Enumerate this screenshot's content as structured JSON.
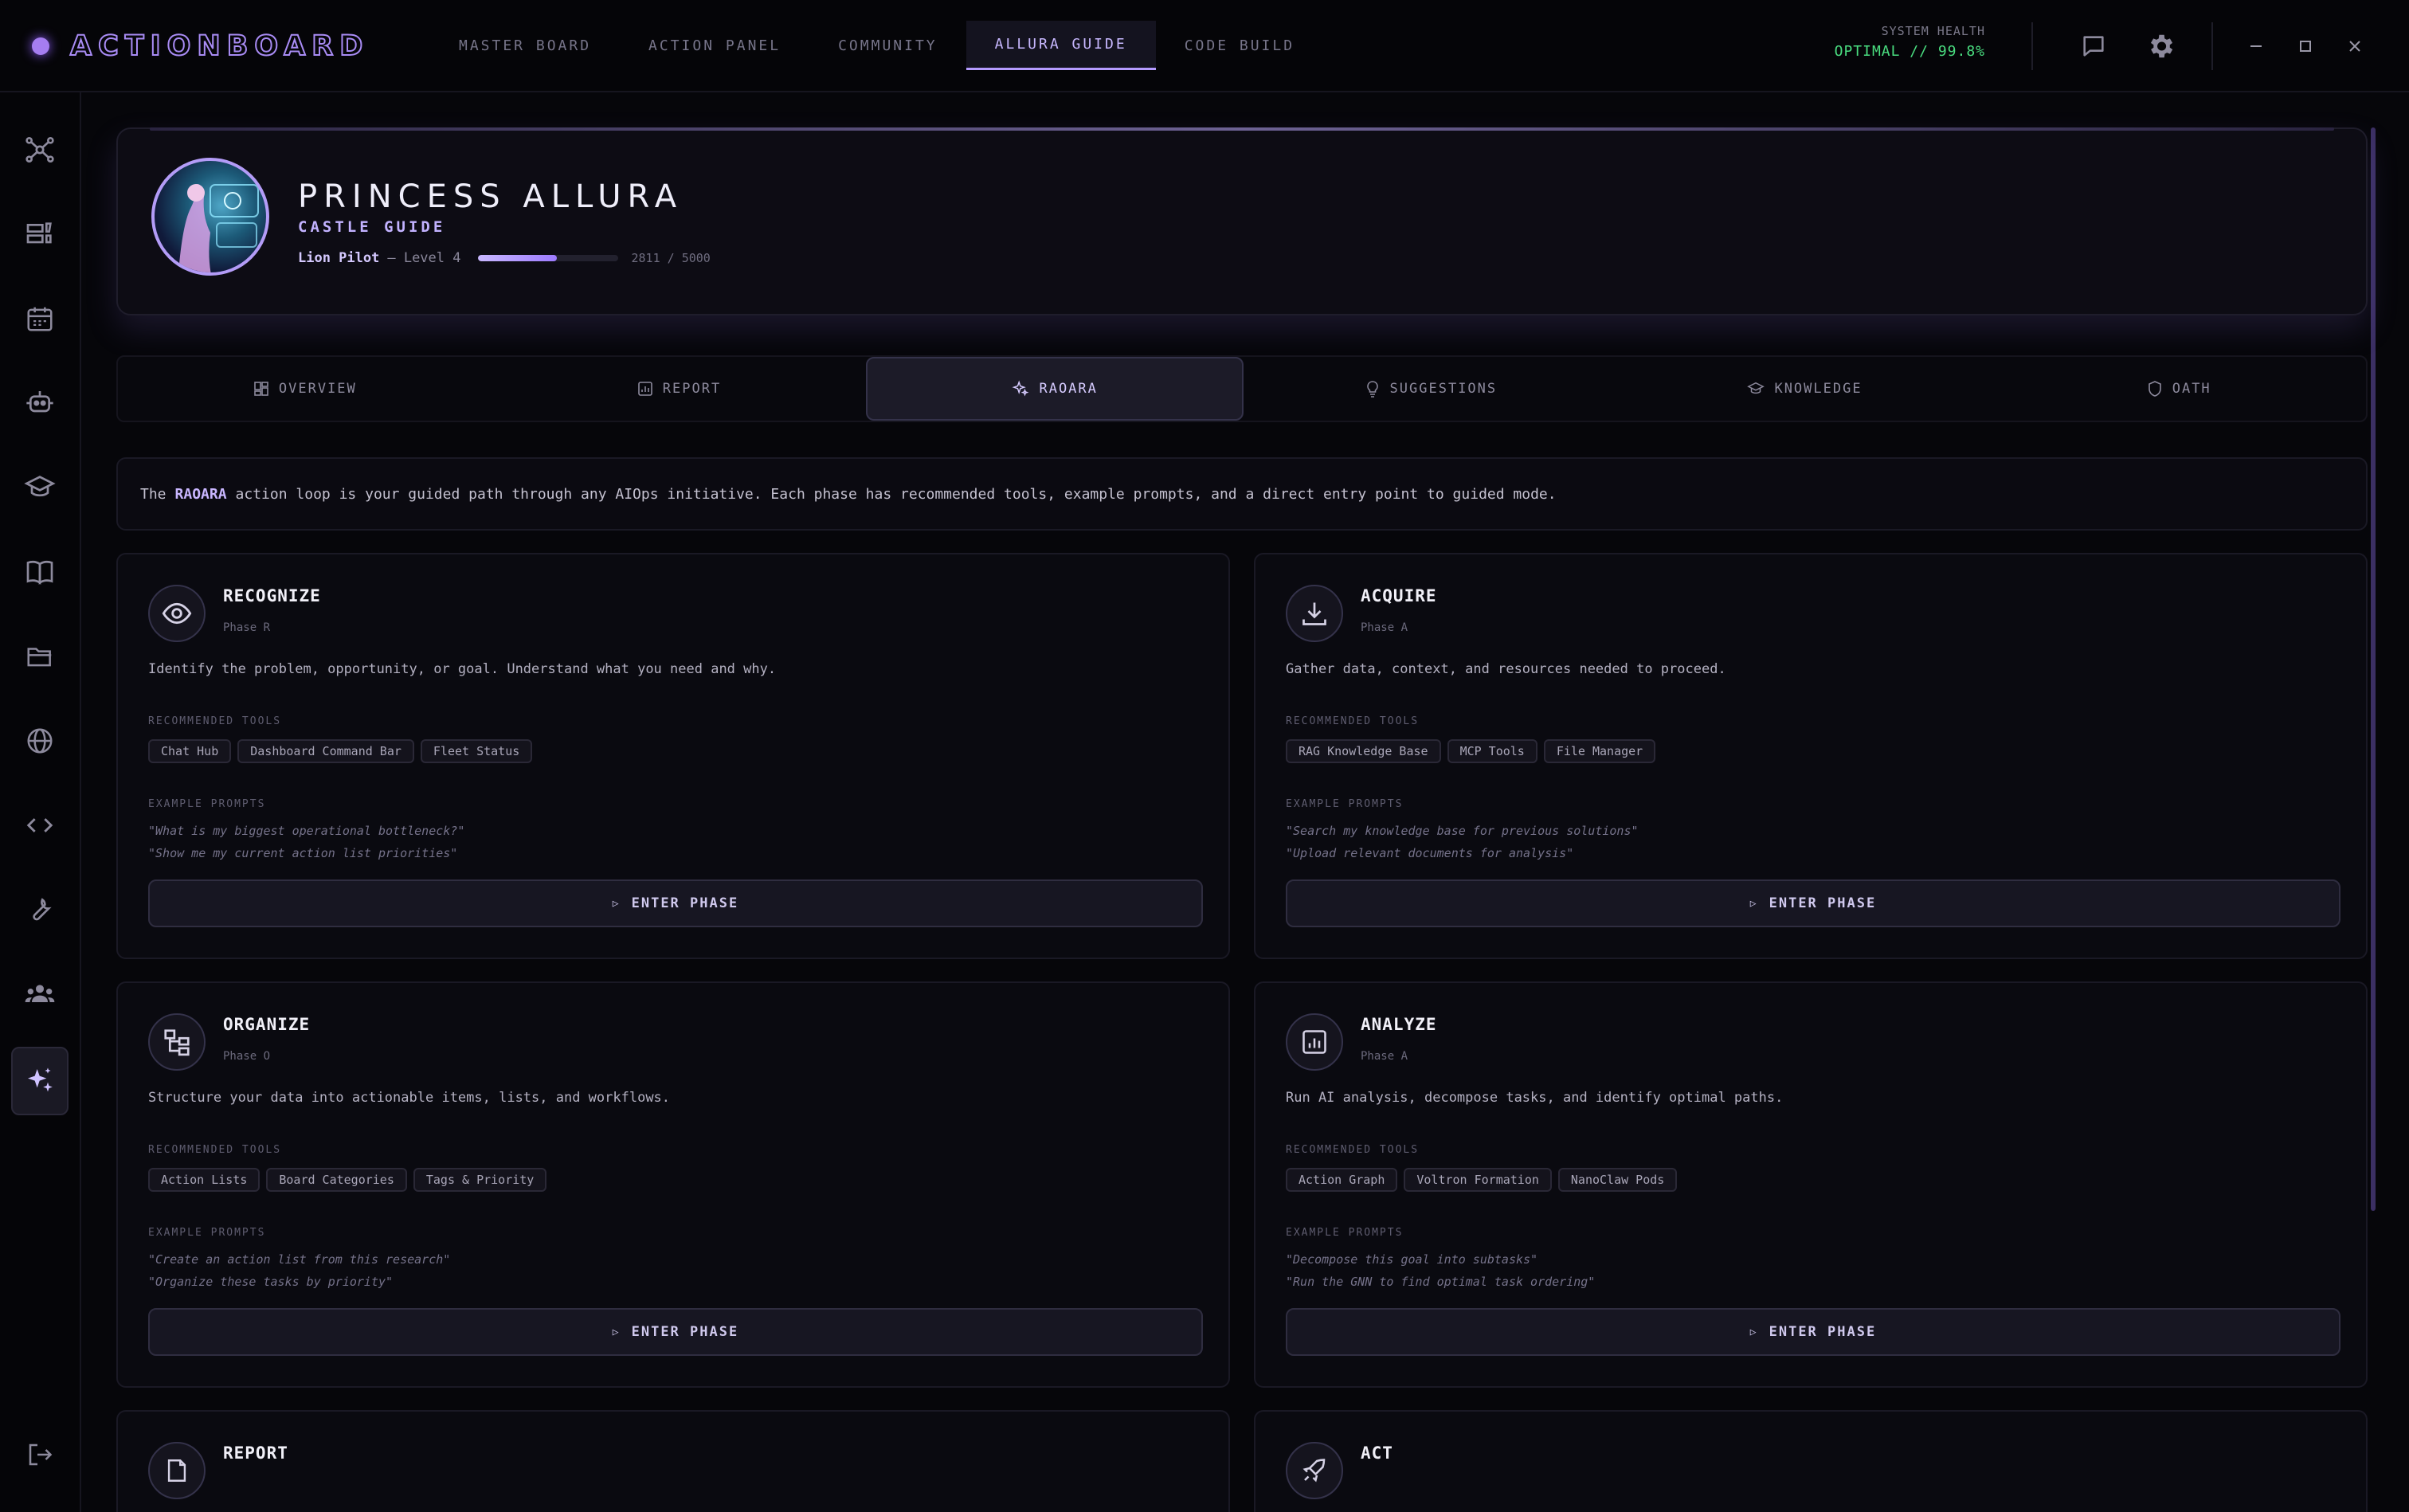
{
  "app": {
    "name": "ACTIONBOARD"
  },
  "topnav": [
    {
      "label": "MASTER BOARD",
      "active": false
    },
    {
      "label": "ACTION PANEL",
      "active": false
    },
    {
      "label": "COMMUNITY",
      "active": false
    },
    {
      "label": "ALLURA GUIDE",
      "active": true
    },
    {
      "label": "CODE BUILD",
      "active": false
    }
  ],
  "system_health": {
    "label": "SYSTEM HEALTH",
    "value": "OPTIMAL // 99.8%"
  },
  "profile": {
    "name": "PRINCESS ALLURA",
    "subtitle": "CASTLE GUIDE",
    "role": "Lion Pilot",
    "level": "— Level 4",
    "xp_text": "2811 / 5000",
    "xp_fraction": 0.5622
  },
  "tabs": [
    {
      "label": "OVERVIEW",
      "icon": "grid-icon",
      "active": false
    },
    {
      "label": "REPORT",
      "icon": "report-icon",
      "active": false
    },
    {
      "label": "RAOARA",
      "icon": "sparkles-icon",
      "active": true
    },
    {
      "label": "SUGGESTIONS",
      "icon": "lightbulb-icon",
      "active": false
    },
    {
      "label": "KNOWLEDGE",
      "icon": "graduation-cap-icon",
      "active": false
    },
    {
      "label": "OATH",
      "icon": "shield-icon",
      "active": false
    }
  ],
  "intro": {
    "prefix": "The",
    "highlight": "RAOARA",
    "suffix": "action loop is your guided path through any AIOps initiative. Each phase has recommended tools, example prompts, and a direct entry point to guided mode."
  },
  "labels": {
    "recommended_tools": "RECOMMENDED TOOLS",
    "example_prompts": "EXAMPLE PROMPTS",
    "enter_phase": "ENTER PHASE"
  },
  "phases": [
    {
      "title": "RECOGNIZE",
      "sub": "Phase R",
      "icon": "eye-icon",
      "description": "Identify the problem, opportunity, or goal. Understand what you need and why.",
      "tools": [
        "Chat Hub",
        "Dashboard Command Bar",
        "Fleet Status"
      ],
      "prompts": [
        "\"What is my biggest operational bottleneck?\"",
        "\"Show me my current action list priorities\""
      ]
    },
    {
      "title": "ACQUIRE",
      "sub": "Phase A",
      "icon": "download-icon",
      "description": "Gather data, context, and resources needed to proceed.",
      "tools": [
        "RAG Knowledge Base",
        "MCP Tools",
        "File Manager"
      ],
      "prompts": [
        "\"Search my knowledge base for previous solutions\"",
        "\"Upload relevant documents for analysis\""
      ]
    },
    {
      "title": "ORGANIZE",
      "sub": "Phase O",
      "icon": "hierarchy-icon",
      "description": "Structure your data into actionable items, lists, and workflows.",
      "tools": [
        "Action Lists",
        "Board Categories",
        "Tags & Priority"
      ],
      "prompts": [
        "\"Create an action list from this research\"",
        "\"Organize these tasks by priority\""
      ]
    },
    {
      "title": "ANALYZE",
      "sub": "Phase A",
      "icon": "chart-icon",
      "description": "Run AI analysis, decompose tasks, and identify optimal paths.",
      "tools": [
        "Action Graph",
        "Voltron Formation",
        "NanoClaw Pods"
      ],
      "prompts": [
        "\"Decompose this goal into subtasks\"",
        "\"Run the GNN to find optimal task ordering\""
      ]
    },
    {
      "title": "REPORT",
      "icon": "document-icon"
    },
    {
      "title": "ACT",
      "icon": "rocket-icon"
    }
  ],
  "sidebar": [
    "network-icon",
    "board-icon",
    "calendar-icon",
    "robot-icon",
    "graduation-cap-icon",
    "book-icon",
    "folder-icon",
    "globe-icon",
    "code-icon",
    "wrench-icon",
    "users-icon",
    "sparkles-icon",
    "logout-icon"
  ],
  "colors": {
    "accent": "#b59bff",
    "health_ok": "#4ade80",
    "background": "#06060a"
  }
}
